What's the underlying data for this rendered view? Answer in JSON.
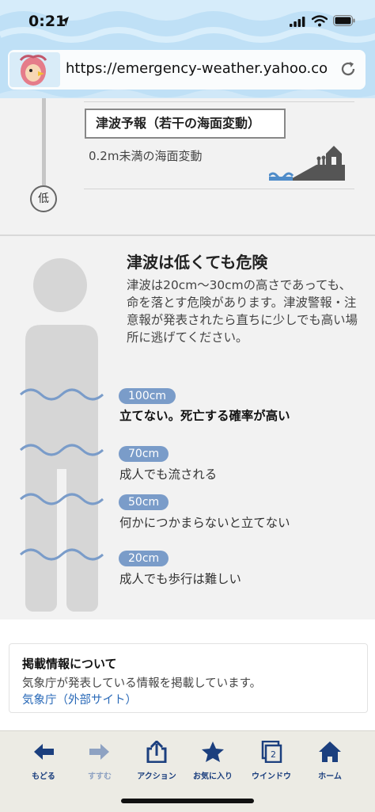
{
  "status_bar": {
    "time": "0:21"
  },
  "url_bar": {
    "url": "https://emergency-weather.yahoo.co.jp..."
  },
  "level_section": {
    "forecast_label": "津波予報（若干の海面変動）",
    "forecast_desc": "0.2m未満の海面変動",
    "low_marker": "低"
  },
  "danger_section": {
    "title": "津波は低くても危険",
    "body": "津波は20cm〜30cmの高さであっても、命を落とす危険があります。津波警報・注意報が発表されたら直ちに少しでも高い場所に逃げてください。",
    "levels": [
      {
        "height": "100cm",
        "label": "立てない。死亡する確率が高い"
      },
      {
        "height": "70cm",
        "label": "成人でも流される"
      },
      {
        "height": "50cm",
        "label": "何かにつかまらないと立てない"
      },
      {
        "height": "20cm",
        "label": "成人でも歩行は難しい"
      }
    ]
  },
  "info": {
    "heading": "掲載情報について",
    "text": "気象庁が発表している情報を掲載しています。",
    "link": "気象庁（外部サイト）"
  },
  "toolbar": {
    "back": "もどる",
    "forward": "すすむ",
    "action": "アクション",
    "favorite": "お気に入り",
    "window": "ウインドウ",
    "window_count": "2",
    "home": "ホーム"
  },
  "colors": {
    "header_bg": "#bfe0f6",
    "wave": "#7a9cc9",
    "toolbar_icon": "#1b3f7e",
    "link": "#2a6ab8"
  }
}
